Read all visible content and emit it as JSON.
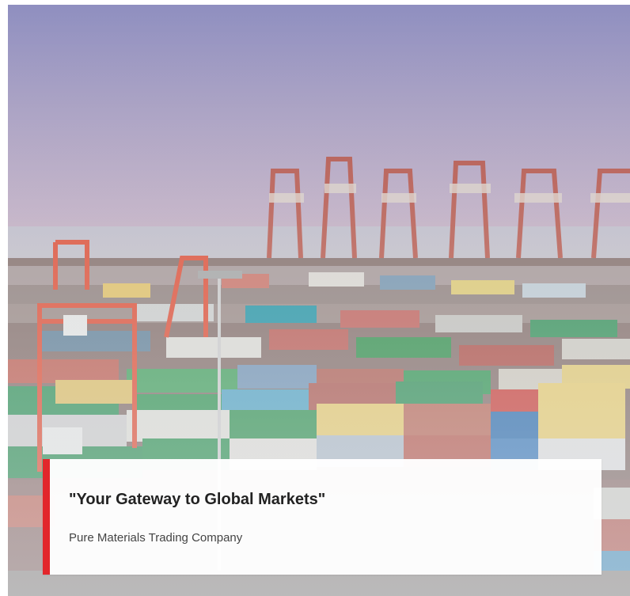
{
  "hero": {
    "image_description_icon": "container-port-photo",
    "caption": {
      "quote": "\"Your Gateway to Global Markets\"",
      "company": "Pure Materials Trading Company"
    }
  },
  "colors": {
    "accent": "#e2262b",
    "card_bg": "#ffffff",
    "title_text": "#222222",
    "subtitle_text": "#444444"
  }
}
